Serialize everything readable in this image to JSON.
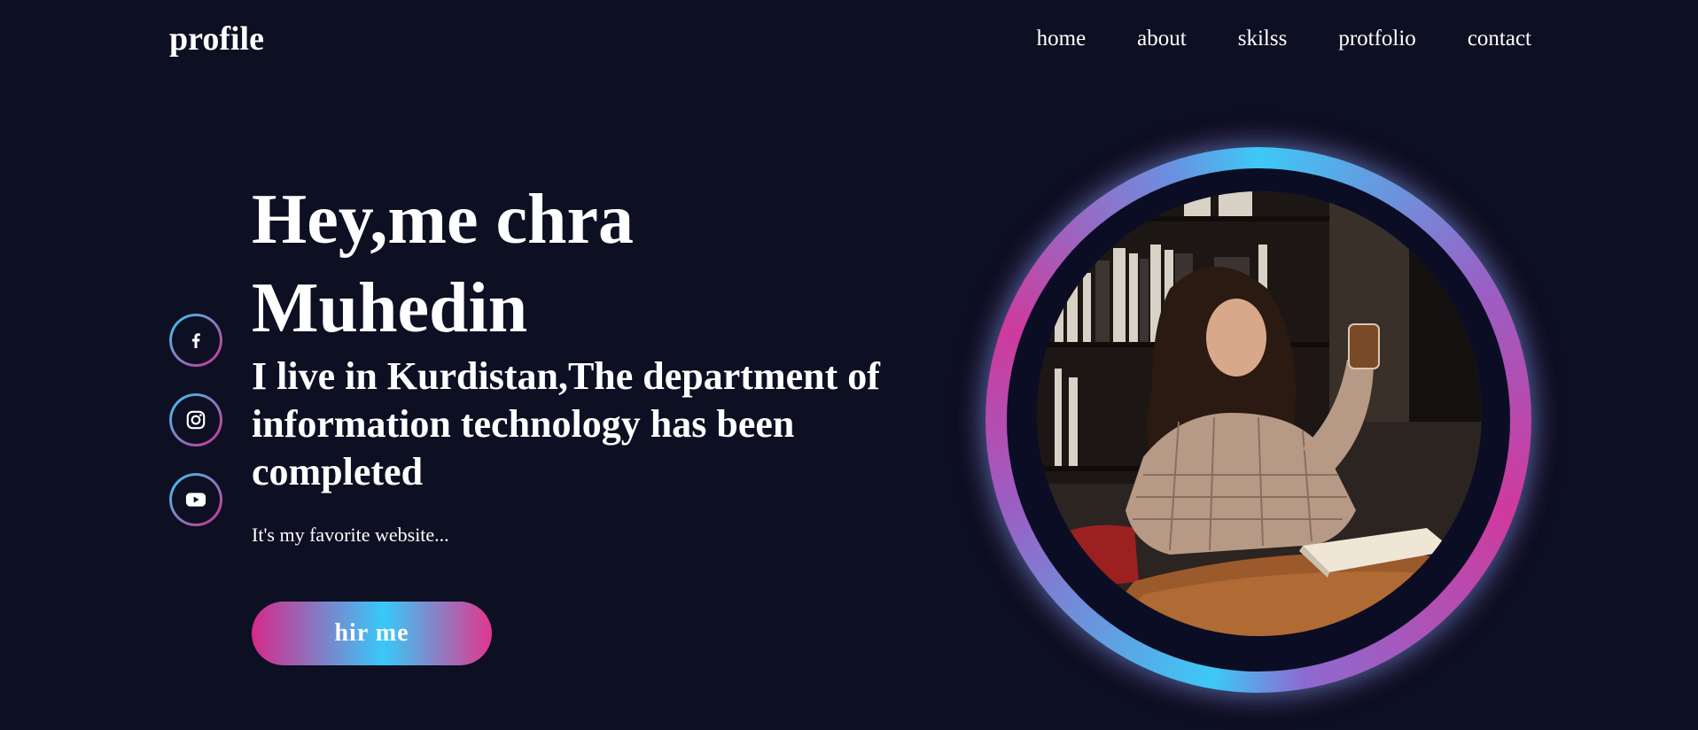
{
  "header": {
    "logo": "profile",
    "nav": [
      "home",
      "about",
      "skilss",
      "protfolio",
      "contact"
    ]
  },
  "socials": [
    {
      "icon": "facebook-icon"
    },
    {
      "icon": "instagram-icon"
    },
    {
      "icon": "youtube-icon"
    }
  ],
  "hero": {
    "title": "Hey,me chra Muhedin",
    "subtitle": "I live in Kurdistan,The department of information technology has been completed",
    "note": "It's my favorite website...",
    "button_label": "hir me"
  },
  "colors": {
    "background": "#0d0f22",
    "accent_blue": "#38c8f5",
    "accent_pink": "#d22f8d",
    "text": "#ffffff"
  }
}
